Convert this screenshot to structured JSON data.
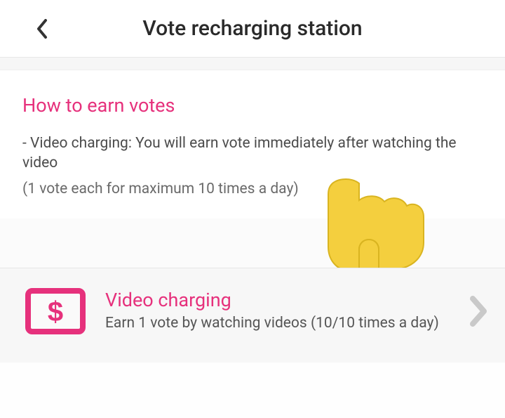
{
  "header": {
    "title": "Vote recharging station"
  },
  "info": {
    "heading": "How to earn votes",
    "line1": "- Video charging: You will earn vote immediately after watching the video",
    "line2": "(1 vote each for maximum 10 times a day)"
  },
  "action": {
    "title": "Video charging",
    "subtitle": "Earn 1 vote by watching videos (10/10 times a day)"
  },
  "colors": {
    "accent": "#e6317c"
  }
}
